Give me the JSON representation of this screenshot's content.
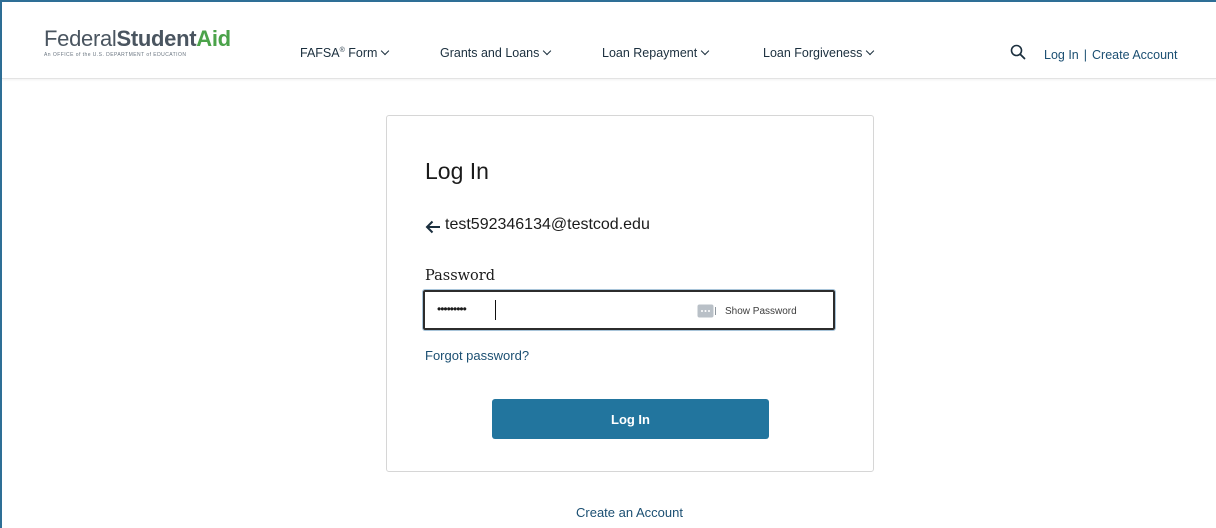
{
  "header": {
    "logo": {
      "federal": "Federal",
      "student": "Student",
      "aid": "Aid",
      "subtitle": "An OFFICE of the U.S. DEPARTMENT of EDUCATION"
    },
    "nav": [
      {
        "label": "FAFSA",
        "sup": "®",
        "suffix": " Form"
      },
      {
        "label": "Grants and Loans"
      },
      {
        "label": "Loan Repayment"
      },
      {
        "label": "Loan Forgiveness"
      }
    ],
    "search_icon": "search-icon",
    "login_link": "Log In",
    "separator": "|",
    "create_account_link": "Create Account"
  },
  "login_card": {
    "title": "Log In",
    "back_icon": "arrow-left-icon",
    "email": "test592346134@testcod.edu",
    "password_label": "Password",
    "password_value": "•••••••••",
    "show_password_label": "Show Password",
    "forgot_password_link": "Forgot password?",
    "submit_label": "Log In"
  },
  "footer": {
    "create_an_account_link": "Create an Account"
  },
  "colors": {
    "brand_blue": "#22759e",
    "link_blue": "#1b4f72",
    "logo_green": "#4ba34a",
    "frame_border": "#2e6f96"
  }
}
